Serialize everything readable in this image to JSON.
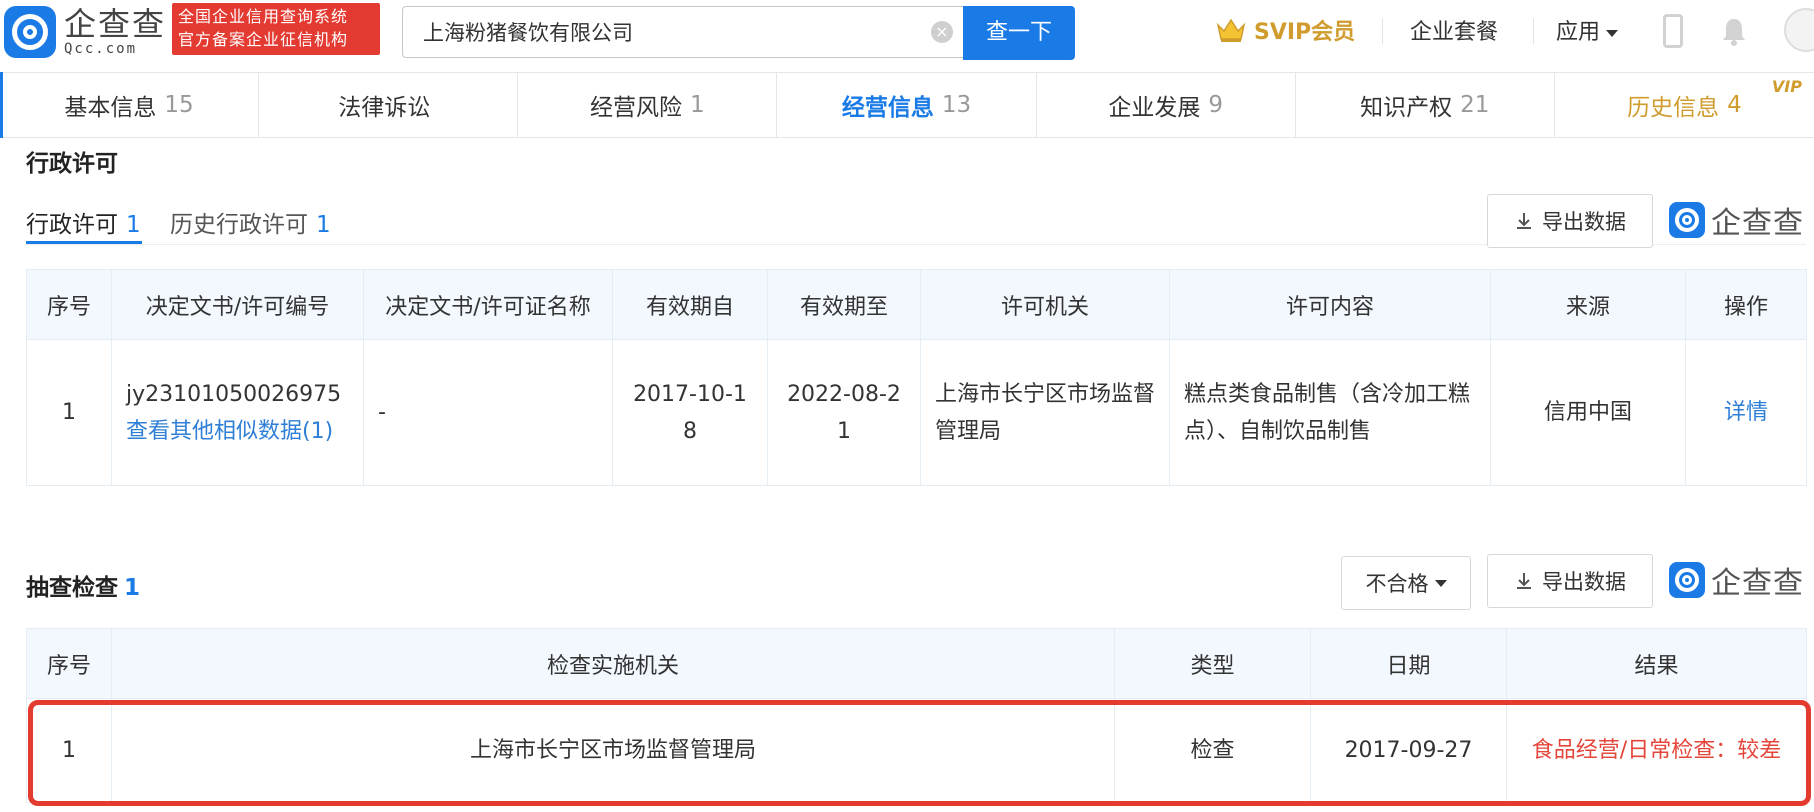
{
  "header": {
    "logo_cn": "企查查",
    "logo_en": "Qcc.com",
    "cert_line1": "全国企业信用查询系统",
    "cert_line2": "官方备案企业征信机构",
    "search_value": "上海粉猪餐饮有限公司",
    "search_button": "查一下",
    "svip": "SVIP会员",
    "enterprise_pkg": "企业套餐",
    "apps": "应用"
  },
  "tabs": [
    {
      "label": "基本信息",
      "count": "15"
    },
    {
      "label": "法律诉讼",
      "count": ""
    },
    {
      "label": "经营风险",
      "count": "1"
    },
    {
      "label": "经营信息",
      "count": "13"
    },
    {
      "label": "企业发展",
      "count": "9"
    },
    {
      "label": "知识产权",
      "count": "21"
    },
    {
      "label": "历史信息",
      "count": "4",
      "tag": "VIP"
    }
  ],
  "license": {
    "section_title": "行政许可",
    "subtab_current": "行政许可",
    "subtab_current_count": "1",
    "subtab_history": "历史行政许可",
    "subtab_history_count": "1",
    "export": "导出数据",
    "brand": "企查查",
    "columns": [
      "序号",
      "决定文书/许可编号",
      "决定文书/许可证名称",
      "有效期自",
      "有效期至",
      "许可机关",
      "许可内容",
      "来源",
      "操作"
    ],
    "row": {
      "index": "1",
      "number": "jy23101050026975",
      "similar_link": "查看其他相似数据(1)",
      "name": "-",
      "from": "2017-10-18",
      "to": "2022-08-21",
      "authority": "上海市长宁区市场监督管理局",
      "content": "糕点类食品制售（含冷加工糕点）、自制饮品制售",
      "source": "信用中国",
      "action": "详情"
    }
  },
  "inspection": {
    "section_title": "抽查检查",
    "count": "1",
    "filter": "不合格",
    "export": "导出数据",
    "brand": "企查查",
    "columns": [
      "序号",
      "检查实施机关",
      "类型",
      "日期",
      "结果"
    ],
    "row": {
      "index": "1",
      "agency": "上海市长宁区市场监督管理局",
      "type": "检查",
      "date": "2017-09-27",
      "result": "食品经营/日常检查：较差"
    }
  },
  "colors": {
    "brand_blue": "#1a7ae6",
    "svip_gold": "#d09c2d",
    "danger_red": "#e5463b",
    "highlight_red": "#e43b2f"
  }
}
